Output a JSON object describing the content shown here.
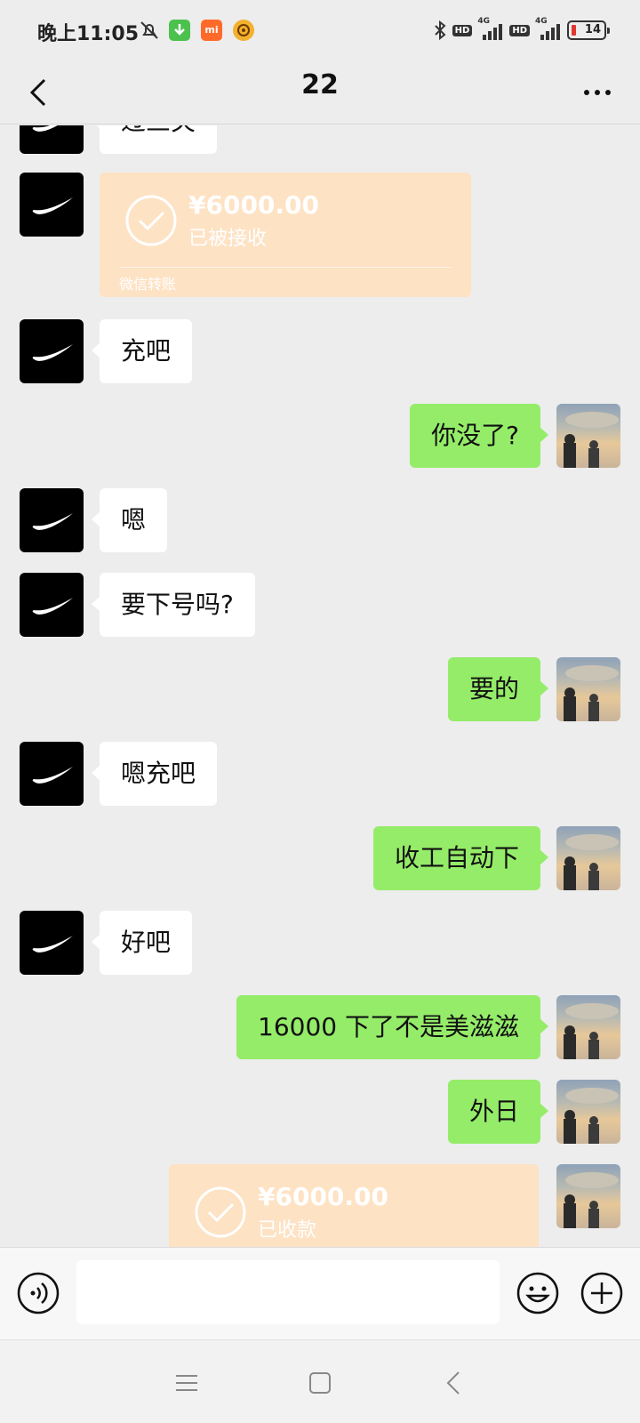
{
  "status_bar": {
    "time": "晚上11:05",
    "mi_label": "mi",
    "hd_label": "HD",
    "network_label": "4G",
    "battery": "14"
  },
  "header": {
    "title": "22"
  },
  "messages": [
    {
      "side": "in",
      "type": "text",
      "text": "过三关"
    },
    {
      "side": "in",
      "type": "transfer",
      "amount": "¥6000.00",
      "status": "已被接收",
      "footer": "微信转账"
    },
    {
      "side": "in",
      "type": "text",
      "text": "充吧"
    },
    {
      "side": "out",
      "type": "text",
      "text": "你没了?"
    },
    {
      "side": "in",
      "type": "text",
      "text": "嗯"
    },
    {
      "side": "in",
      "type": "text",
      "text": "要下号吗?"
    },
    {
      "side": "out",
      "type": "text",
      "text": "要的"
    },
    {
      "side": "in",
      "type": "text",
      "text": "嗯充吧"
    },
    {
      "side": "out",
      "type": "text",
      "text": "收工自动下"
    },
    {
      "side": "in",
      "type": "text",
      "text": "好吧"
    },
    {
      "side": "out",
      "type": "text",
      "text": "16000 下了不是美滋滋"
    },
    {
      "side": "out",
      "type": "text",
      "text": "外日"
    },
    {
      "side": "out",
      "type": "transfer",
      "amount": "¥6000.00",
      "status": "已收款",
      "footer": ""
    }
  ],
  "input": {
    "value": "",
    "placeholder": ""
  },
  "icons": {
    "back": "chevron-left-icon",
    "more": "more-icon",
    "voice": "voice-icon",
    "emoji": "emoji-icon",
    "plus": "plus-icon",
    "menu": "menu-icon",
    "home": "home-icon",
    "nav_back": "back-icon"
  },
  "colors": {
    "outgoing_bubble": "#95ec69",
    "incoming_bubble": "#ffffff",
    "transfer_card": "#fde2c4",
    "background": "#ededed"
  }
}
